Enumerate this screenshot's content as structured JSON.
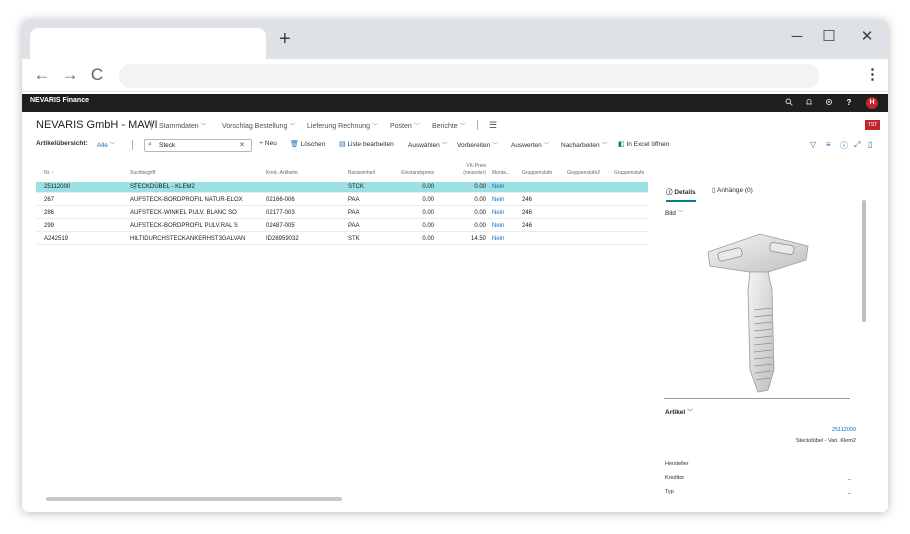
{
  "browser": {
    "new_tab": "+",
    "minimize": "─",
    "maximize": "☐",
    "close": "✕",
    "back": "←",
    "forward": "→",
    "reload": "C",
    "menu": "⋮"
  },
  "app": {
    "title": "NEVARIS Finance",
    "user_initial": "H",
    "icons": [
      "search-icon",
      "bell-icon",
      "gear-icon",
      "help-icon"
    ],
    "help_glyph": "?"
  },
  "header": {
    "company": "NEVARIS GmbH - MAWI",
    "menu": [
      {
        "label": "Stammdaten",
        "dropdown": true
      },
      {
        "label": "Vorschlag Bestellung",
        "dropdown": true
      },
      {
        "label": "Lieferung Rechnung",
        "dropdown": true
      },
      {
        "label": "Posten",
        "dropdown": true
      },
      {
        "label": "Berichte",
        "dropdown": true
      }
    ],
    "badge": "TST"
  },
  "actions": {
    "view_label": "Artikelübersicht:",
    "filter_label": "Alle",
    "search_value": "Steck",
    "new_label": "Neu",
    "delete_label": "Löschen",
    "edit_list_label": "Liste bearbeiten",
    "select_label": "Auswählen",
    "prepare_label": "Vorbereiten",
    "evaluate_label": "Auswerten",
    "processing_label": "Nacharbeiten",
    "excel_label": "In Excel öffnen"
  },
  "table": {
    "headers": {
      "nr": "Nr. ↑",
      "search": "Suchbegriff",
      "vendor_item": "Kred.-Artikelnr.",
      "base_unit": "Basiseinheit",
      "unit_cost": "Einstandspreis",
      "vk_price_1": "VK-Preis",
      "vk_price_2": "(neuester)",
      "montage": "Monta...",
      "group1": "Gruppenstufe",
      "group2": "Gruppenstufe2",
      "group3": "Gruppenstufe"
    },
    "rows": [
      {
        "nr": "25112000",
        "search": "STECKDÜBEL - KLEM2",
        "vendor_item": "",
        "unit": "STCK",
        "cost": "0.00",
        "price": "0.00",
        "montage": "Nein",
        "group": ""
      },
      {
        "nr": "267",
        "search": "AUFSTECK-BORDPROFIL NATUR-ELOX",
        "vendor_item": "02166-006",
        "unit": "PAA",
        "cost": "0.00",
        "price": "0.00",
        "montage": "Nein",
        "group": "246"
      },
      {
        "nr": "286",
        "search": "AUFSTECK-WINKEL PULV. BLANC SO",
        "vendor_item": "02177-003",
        "unit": "PAA",
        "cost": "0.00",
        "price": "0.00",
        "montage": "Nein",
        "group": "246"
      },
      {
        "nr": "299",
        "search": "AUFSTECK-BORDPROFIL PULV.RAL S",
        "vendor_item": "02487-005",
        "unit": "PAA",
        "cost": "0.00",
        "price": "0.00",
        "montage": "Nein",
        "group": "246"
      },
      {
        "nr": "A242519",
        "search": "HILTIDURCHSTECKANKERHST3GALVAN",
        "vendor_item": "ID26959032",
        "unit": "STK",
        "cost": "0.00",
        "price": "14.50",
        "montage": "Nein",
        "group": ""
      }
    ]
  },
  "factbox": {
    "tab_details": "Details",
    "tab_attachments": "Anhänge (0)",
    "image_section": "Bild",
    "item_section": "Artikel",
    "item_no": "25112000",
    "item_desc": "Steckdübel - Vari. Klem2",
    "manufacturer_label": "Hersteller",
    "vendor_label": "Kreditor",
    "type_label": "Typ",
    "empty_value": "_"
  }
}
